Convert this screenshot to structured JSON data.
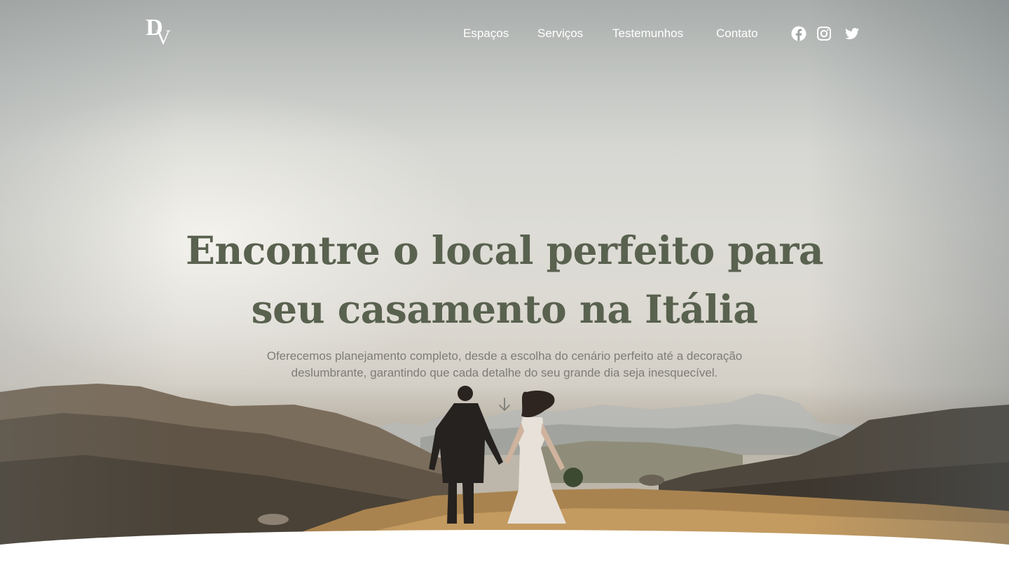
{
  "brand": {
    "logo_text_1": "D",
    "logo_text_2": "V"
  },
  "nav": {
    "links": [
      {
        "label": "Espaços"
      },
      {
        "label": "Serviços"
      },
      {
        "label": "Testemunhos"
      },
      {
        "label": "Contato"
      }
    ],
    "social_icons": [
      "facebook-icon",
      "instagram-icon",
      "twitter-icon"
    ]
  },
  "hero": {
    "headline": "Encontre o local perfeito para seu casamento na Itália",
    "subtitle": "Oferecemos planejamento completo, desde a escolha do cenário perfeito até a decoração deslumbrante, garantindo que cada detalhe do seu grande dia seja inesquecível.",
    "scroll_icon": "arrow-down-icon",
    "image_subject": "couple-walking-hills-icon"
  },
  "colors": {
    "headline": "#59614f",
    "subtitle": "#7d7c76",
    "nav_text": "#ffffff",
    "background": "#ffffff"
  }
}
